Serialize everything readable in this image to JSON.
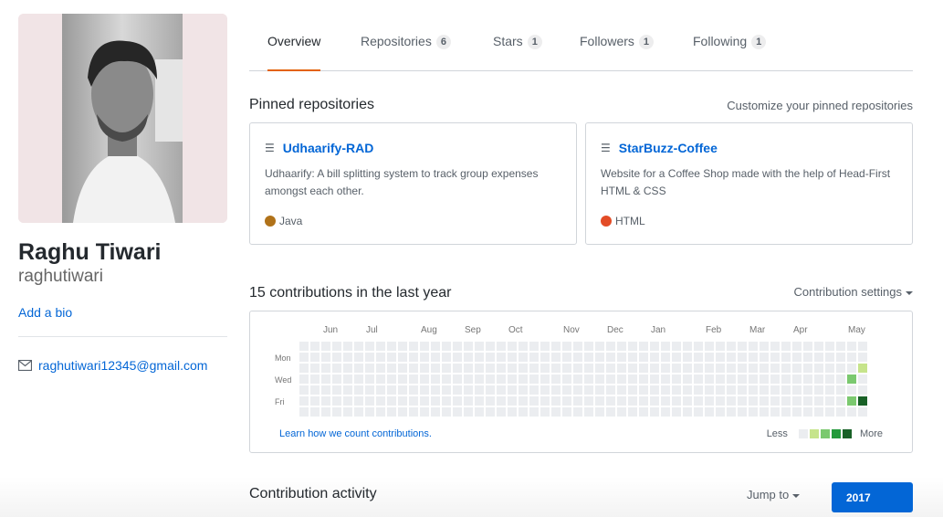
{
  "profile": {
    "fullname": "Raghu Tiwari",
    "username": "raghutiwari",
    "add_bio": "Add a bio",
    "email": "raghutiwari12345@gmail.com"
  },
  "tabs": [
    {
      "label": "Overview",
      "count": null,
      "active": true
    },
    {
      "label": "Repositories",
      "count": "6"
    },
    {
      "label": "Stars",
      "count": "1"
    },
    {
      "label": "Followers",
      "count": "1"
    },
    {
      "label": "Following",
      "count": "1"
    }
  ],
  "pinned": {
    "title": "Pinned repositories",
    "customize": "Customize your pinned repositories",
    "repos": [
      {
        "icon": "repo-icon",
        "name": "Udhaarify-RAD",
        "description": "Udhaarify: A bill splitting system to track group expenses amongst each other.",
        "language": "Java",
        "language_color": "#b07219"
      },
      {
        "icon": "repo-icon",
        "name": "StarBuzz-Coffee",
        "description": "Website for a Coffee Shop made with the help of Head-First HTML & CSS",
        "language": "HTML",
        "language_color": "#e34c26"
      }
    ]
  },
  "contributions": {
    "title": "15 contributions in the last year",
    "settings": "Contribution settings",
    "months": [
      "Jun",
      "Jul",
      "Aug",
      "Sep",
      "Oct",
      "Nov",
      "Dec",
      "Jan",
      "Feb",
      "Mar",
      "Apr",
      "May"
    ],
    "days": [
      "Mon",
      "Wed",
      "Fri"
    ],
    "learn_link": "Learn how we count contributions.",
    "legend_less": "Less",
    "legend_more": "More",
    "colors": [
      "#ebedf0",
      "#c6e48b",
      "#7bc96f",
      "#239a3b",
      "#196127"
    ],
    "active_cells": [
      {
        "week": 51,
        "day": 2,
        "level": 1
      },
      {
        "week": 50,
        "day": 3,
        "level": 2
      },
      {
        "week": 50,
        "day": 5,
        "level": 2
      },
      {
        "week": 51,
        "day": 5,
        "level": 4
      }
    ]
  },
  "activity": {
    "title": "Contribution activity",
    "jump_to": "Jump to",
    "year": "2017"
  }
}
